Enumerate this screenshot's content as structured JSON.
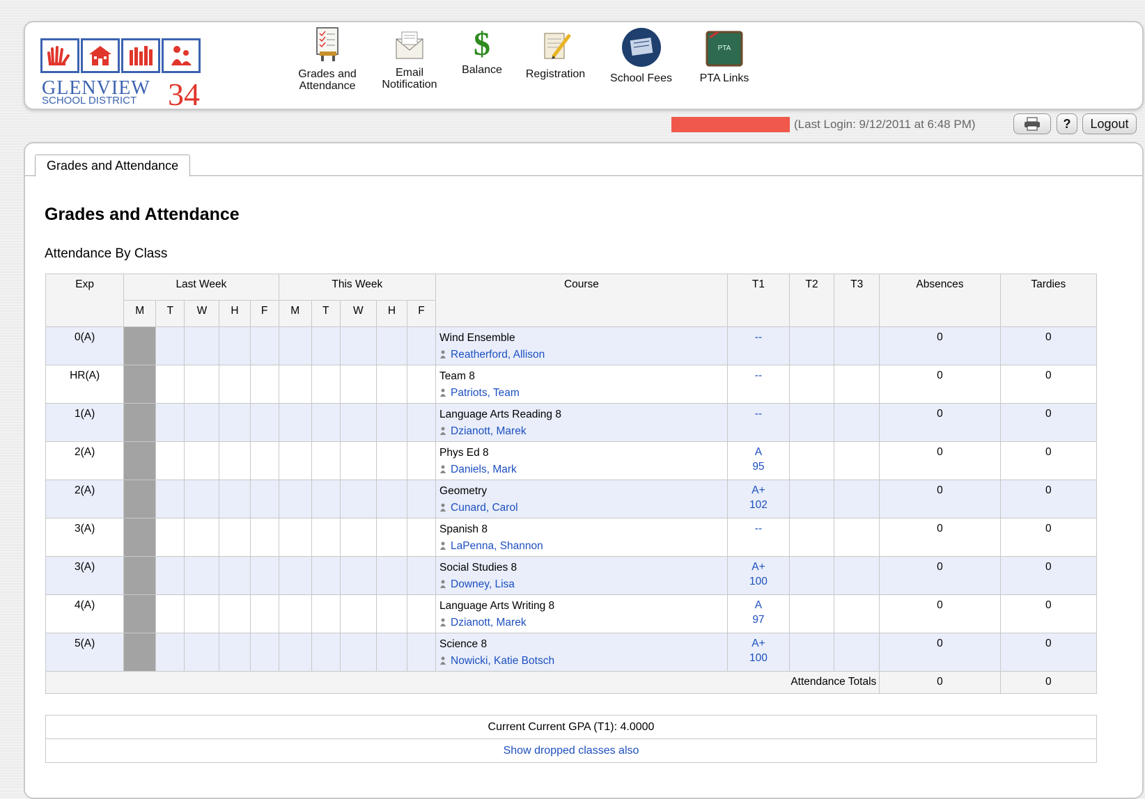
{
  "logo": {
    "name_line1": "GLENVIEW",
    "name_line2": "SCHOOL DISTRICT",
    "number": "34"
  },
  "nav": [
    {
      "label_line1": "Grades and",
      "label_line2": "Attendance",
      "icon": "grades-attendance-icon"
    },
    {
      "label_line1": "Email",
      "label_line2": "Notification",
      "icon": "envelope-icon"
    },
    {
      "label_line1": "Balance",
      "label_line2": "",
      "icon": "dollar-icon"
    },
    {
      "label_line1": "Registration",
      "label_line2": "",
      "icon": "scroll-pencil-icon"
    },
    {
      "label_line1": "School Fees",
      "label_line2": "",
      "icon": "fees-icon"
    },
    {
      "label_line1": "PTA Links",
      "label_line2": "",
      "icon": "pta-board-icon"
    }
  ],
  "user_bar": {
    "last_login": "(Last Login: 9/12/2011 at 6:48 PM)",
    "print_icon": "printer-icon",
    "help_label": "?",
    "logout_label": "Logout"
  },
  "tab_label": "Grades and Attendance",
  "page_title": "Grades and Attendance",
  "section_title": "Attendance By Class",
  "table": {
    "headers": {
      "exp": "Exp",
      "last_week": "Last Week",
      "this_week": "This Week",
      "course": "Course",
      "t1": "T1",
      "t2": "T2",
      "t3": "T3",
      "absences": "Absences",
      "tardies": "Tardies",
      "days": [
        "M",
        "T",
        "W",
        "H",
        "F"
      ]
    },
    "rows": [
      {
        "exp": "0(A)",
        "course": "Wind Ensemble",
        "teacher": "Reatherford, Allison",
        "t1_letter": "--",
        "t1_score": "",
        "absences": "0",
        "tardies": "0"
      },
      {
        "exp": "HR(A)",
        "course": "Team 8",
        "teacher": "Patriots, Team",
        "t1_letter": "--",
        "t1_score": "",
        "absences": "0",
        "tardies": "0"
      },
      {
        "exp": "1(A)",
        "course": "Language Arts Reading 8",
        "teacher": "Dzianott, Marek",
        "t1_letter": "--",
        "t1_score": "",
        "absences": "0",
        "tardies": "0"
      },
      {
        "exp": "2(A)",
        "course": "Phys Ed 8",
        "teacher": "Daniels, Mark",
        "t1_letter": "A",
        "t1_score": "95",
        "absences": "0",
        "tardies": "0"
      },
      {
        "exp": "2(A)",
        "course": "Geometry",
        "teacher": "Cunard, Carol",
        "t1_letter": "A+",
        "t1_score": "102",
        "absences": "0",
        "tardies": "0"
      },
      {
        "exp": "3(A)",
        "course": "Spanish 8",
        "teacher": "LaPenna, Shannon",
        "t1_letter": "--",
        "t1_score": "",
        "absences": "0",
        "tardies": "0"
      },
      {
        "exp": "3(A)",
        "course": "Social Studies 8",
        "teacher": "Downey, Lisa",
        "t1_letter": "A+",
        "t1_score": "100",
        "absences": "0",
        "tardies": "0"
      },
      {
        "exp": "4(A)",
        "course": "Language Arts Writing 8",
        "teacher": "Dzianott, Marek",
        "t1_letter": "A",
        "t1_score": "97",
        "absences": "0",
        "tardies": "0"
      },
      {
        "exp": "5(A)",
        "course": "Science 8",
        "teacher": "Nowicki, Katie Botsch",
        "t1_letter": "A+",
        "t1_score": "100",
        "absences": "0",
        "tardies": "0"
      }
    ],
    "totals": {
      "label": "Attendance Totals",
      "absences": "0",
      "tardies": "0"
    }
  },
  "gpa_text": "Current Current GPA (T1): 4.0000",
  "show_dropped_link": "Show dropped classes also",
  "colors": {
    "accent_blue": "#3c63b0",
    "link_blue": "#1d4fbf",
    "brand_red": "#e0362c",
    "alert_red": "#f0584c"
  }
}
